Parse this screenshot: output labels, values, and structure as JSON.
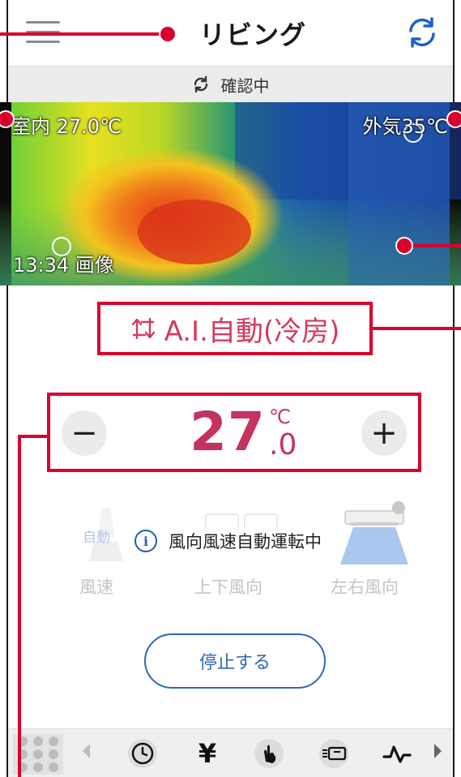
{
  "header": {
    "title": "リビング",
    "menu_icon": "hamburger-menu-icon",
    "refresh_icon": "refresh-icon"
  },
  "status": {
    "text": "確認中",
    "icon": "sync-icon"
  },
  "thermal": {
    "indoor_label": "室内 27.0℃",
    "outdoor_label": "外気35℃",
    "time_label": "13:34 画像"
  },
  "mode": {
    "label": "A.I.自動(冷房)",
    "icon": "auto-swap-arrows-icon",
    "color": "#d23b5e"
  },
  "temperature": {
    "integer": "27",
    "decimal": ".0",
    "unit": "℃",
    "minus_label": "−",
    "plus_label": "+",
    "color": "#c4335d"
  },
  "fan": {
    "auto_tag": "自動",
    "info_message": "風向風速自動運転中",
    "info_icon_glyph": "i",
    "speed_label": "風速",
    "updown_label": "上下風向",
    "leftright_label": "左右風向"
  },
  "stop_button": {
    "label": "停止する",
    "color": "#2e67b8"
  },
  "bottom_bar": {
    "yen_glyph": "¥",
    "icons": [
      "grid-menu-icon",
      "clock-icon",
      "yen-icon",
      "touch-hand-icon",
      "aircon-unit-icon",
      "graph-icon"
    ]
  },
  "annotation_color": "#d8002f"
}
